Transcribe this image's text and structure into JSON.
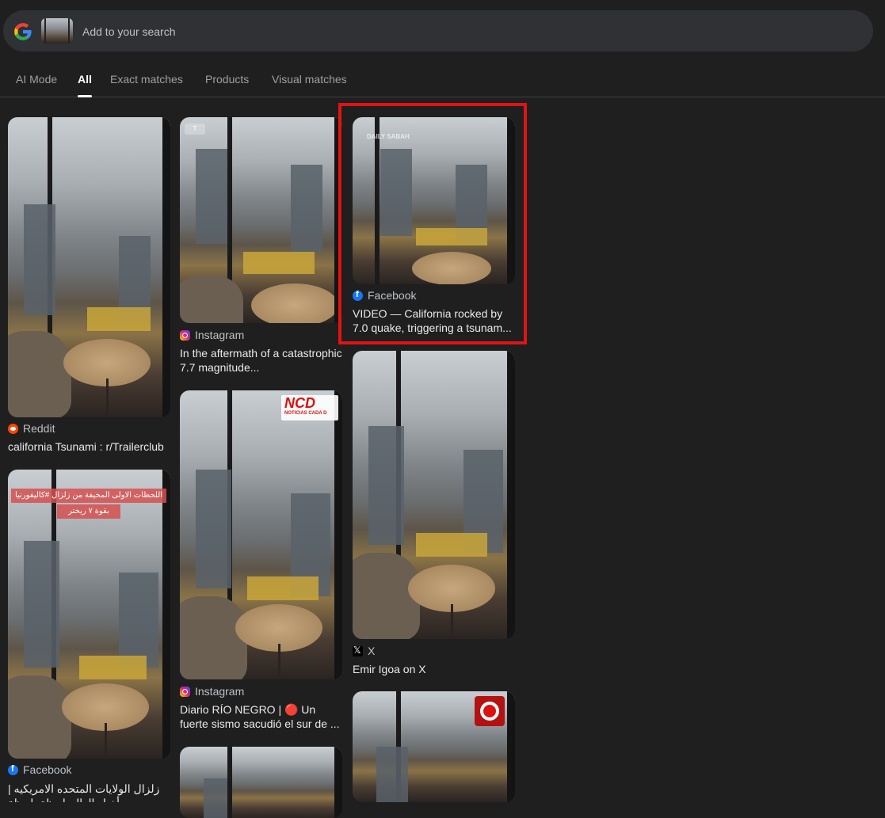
{
  "search": {
    "placeholder": "Add to your search"
  },
  "tabs": [
    {
      "label": "AI Mode",
      "active": false
    },
    {
      "label": "All",
      "active": true
    },
    {
      "label": "Exact matches",
      "active": false
    },
    {
      "label": "Products",
      "active": false
    },
    {
      "label": "Visual matches",
      "active": false
    }
  ],
  "results": [
    {
      "source": "Reddit",
      "title": "california Tsunami : r/Trailerclub"
    },
    {
      "source": "Facebook",
      "title": "زلزال الولايات المتحده الامريكيه | أخبار العالم لحظة بلحظة"
    },
    {
      "source": "Instagram",
      "title": "In the aftermath of a catastrophic 7.7 magnitude..."
    },
    {
      "source": "Instagram",
      "title": "Diario RÍO NEGRO | 🔴 Un fuerte sismo sacudió el sur de ..."
    },
    {
      "source": "Facebook",
      "title": "VIDEO — California rocked by 7.0 quake, triggering a tsunam..."
    },
    {
      "source": "X",
      "title": "Emir Igoa on X"
    }
  ],
  "overlays": {
    "arabic_line1": "اللحظات الاولى المخيفة من زلزال #كاليفورنيا",
    "arabic_line2": "بقوة ٧ ريختر",
    "daily_sabah": "DAILY SABAH",
    "ncd": "NCD",
    "ncd_sub": "NOTICIAS CADA D"
  },
  "colors": {
    "background": "#1f1f1f",
    "highlight": "#e01414",
    "facebook": "#1877f2",
    "reddit": "#ff4500"
  }
}
